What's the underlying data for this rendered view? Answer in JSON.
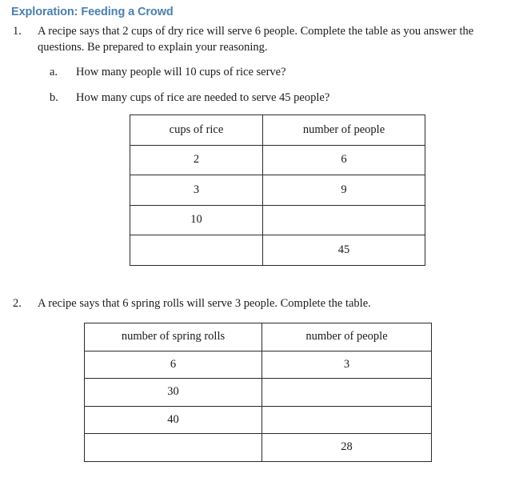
{
  "document": {
    "heading": "Exploration: Feeding a Crowd",
    "heading_color": "#4b7fae"
  },
  "problems": [
    {
      "marker": "1.",
      "text": "A recipe says that 2 cups of dry rice will serve 6 people. Complete the table as you answer the questions. Be prepared to explain your reasoning.",
      "subquestions": [
        {
          "marker": "a.",
          "text": "How many people will 10 cups of rice serve?"
        },
        {
          "marker": "b.",
          "text": "How many cups of rice are needed to serve 45 people?"
        }
      ]
    },
    {
      "marker": "2.",
      "text": "A recipe says that 6 spring rolls will serve 3 people. Complete the table."
    }
  ],
  "tables": [
    {
      "name": "rice-table",
      "headers": [
        "cups of rice",
        "number of people"
      ],
      "rows": [
        [
          "2",
          "6"
        ],
        [
          "3",
          "9"
        ],
        [
          "10",
          ""
        ],
        [
          "",
          "45"
        ]
      ]
    },
    {
      "name": "spring-rolls-table",
      "headers": [
        "number of spring rolls",
        "number of people"
      ],
      "rows": [
        [
          "6",
          "3"
        ],
        [
          "30",
          ""
        ],
        [
          "40",
          ""
        ],
        [
          "",
          "28"
        ]
      ]
    }
  ]
}
